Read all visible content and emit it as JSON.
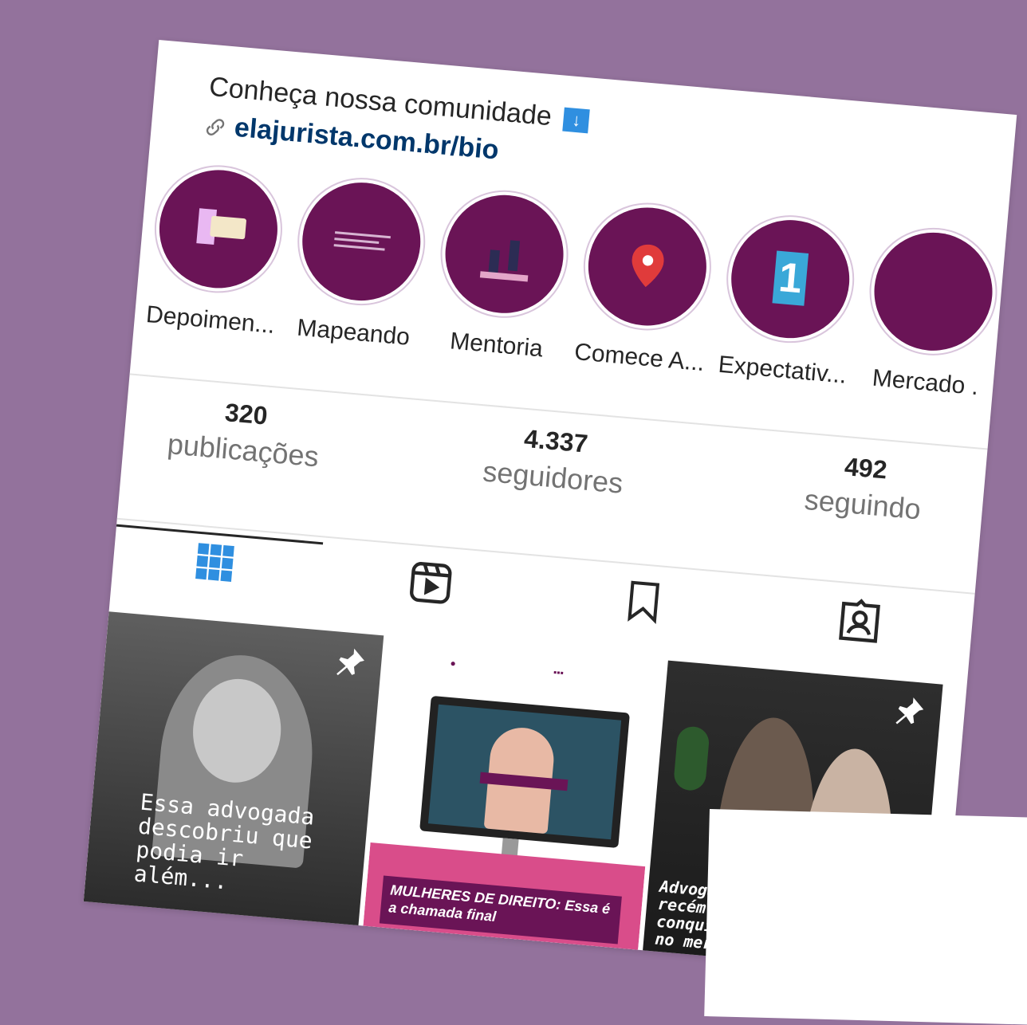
{
  "bio": {
    "text": "Conheça nossa comunidade",
    "arrow_icon": "down-arrow-emoji",
    "link_icon": "link-icon",
    "link_text": "elajurista.com.br/bio"
  },
  "highlights": [
    {
      "label": "Depoimen..."
    },
    {
      "label": "Mapeando"
    },
    {
      "label": "Mentoria"
    },
    {
      "label": "Comece A..."
    },
    {
      "label": "Expectativ..."
    },
    {
      "label": "Mercado ."
    }
  ],
  "stats": {
    "posts": {
      "value": "320",
      "label": "publicações"
    },
    "followers": {
      "value": "4.337",
      "label": "seguidores"
    },
    "following": {
      "value": "492",
      "label": "seguindo"
    }
  },
  "tabs": {
    "posts_icon": "grid-icon",
    "reels_icon": "reels-icon",
    "saved_icon": "bookmark-icon",
    "tagged_icon": "tagged-user-icon",
    "active": "posts"
  },
  "posts": [
    {
      "caption": "Essa advogada descobriu que podia ir além...",
      "pinned": true
    },
    {
      "banner": "MULHERES DE DIREITO: Essa é a chamada final",
      "pinned": false
    },
    {
      "caption": "Advoga recém-f conqui no merc",
      "pinned": true
    }
  ],
  "colors": {
    "highlight_bg": "#6a1456",
    "background": "#93729c",
    "link": "#00376b"
  }
}
